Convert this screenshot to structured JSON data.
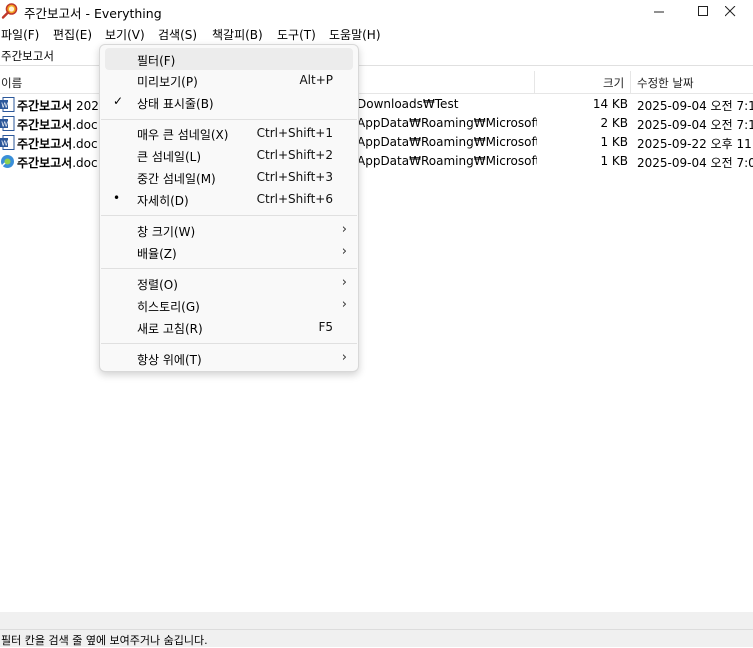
{
  "window": {
    "title": "주간보고서 - Everything"
  },
  "menubar": {
    "items": [
      "파일(F)",
      "편집(E)",
      "보기(V)",
      "검색(S)",
      "책갈피(B)",
      "도구(T)",
      "도움말(H)"
    ]
  },
  "search": {
    "value": "주간보고서"
  },
  "columns": {
    "name": "이름",
    "size": "크기",
    "date": "수정한 날짜"
  },
  "rows": [
    {
      "name_bold": "주간보고서",
      "name_rest": " 202",
      "path": "Downloads₩Test",
      "size": "14 KB",
      "date": "2025-09-04 오전 7:1"
    },
    {
      "name_bold": "주간보고서",
      "name_rest": ".doc",
      "path": "AppData₩Roaming₩Microsoft...",
      "size": "2 KB",
      "date": "2025-09-04 오전 7:1"
    },
    {
      "name_bold": "주간보고서",
      "name_rest": ".doc",
      "path": "AppData₩Roaming₩Microsoft...",
      "size": "1 KB",
      "date": "2025-09-22 오후 11:"
    },
    {
      "name_bold": "주간보고서",
      "name_rest": ".doc",
      "path": "AppData₩Roaming₩Microsoft...",
      "size": "1 KB",
      "date": "2025-09-04 오전 7:0"
    }
  ],
  "view_menu": {
    "items": [
      {
        "label": "필터(F)",
        "shortcut": "",
        "mark": "",
        "submenu": false
      },
      {
        "label": "미리보기(P)",
        "shortcut": "Alt+P",
        "mark": "",
        "submenu": false
      },
      {
        "label": "상태 표시줄(B)",
        "shortcut": "",
        "mark": "✓",
        "submenu": false
      },
      {
        "label": "매우 큰 섬네일(X)",
        "shortcut": "Ctrl+Shift+1",
        "mark": "",
        "submenu": false
      },
      {
        "label": "큰 섬네일(L)",
        "shortcut": "Ctrl+Shift+2",
        "mark": "",
        "submenu": false
      },
      {
        "label": "중간 섬네일(M)",
        "shortcut": "Ctrl+Shift+3",
        "mark": "",
        "submenu": false
      },
      {
        "label": "자세히(D)",
        "shortcut": "Ctrl+Shift+6",
        "mark": "•",
        "submenu": false
      },
      {
        "label": "창 크기(W)",
        "shortcut": "",
        "mark": "",
        "submenu": true
      },
      {
        "label": "배율(Z)",
        "shortcut": "",
        "mark": "",
        "submenu": true
      },
      {
        "label": "정렬(O)",
        "shortcut": "",
        "mark": "",
        "submenu": true
      },
      {
        "label": "히스토리(G)",
        "shortcut": "",
        "mark": "",
        "submenu": true
      },
      {
        "label": "새로 고침(R)",
        "shortcut": "F5",
        "mark": "",
        "submenu": false
      },
      {
        "label": "항상 위에(T)",
        "shortcut": "",
        "mark": "",
        "submenu": true
      }
    ],
    "submenu_arrow": "›"
  },
  "statusbar": {
    "text": "필터 칸을 검색 줄 옆에 보여주거나 숨깁니다."
  },
  "colors": {
    "menu_bg": "#f9f9f9",
    "hover": "#ececec",
    "status_bg": "#f0f0f0"
  }
}
